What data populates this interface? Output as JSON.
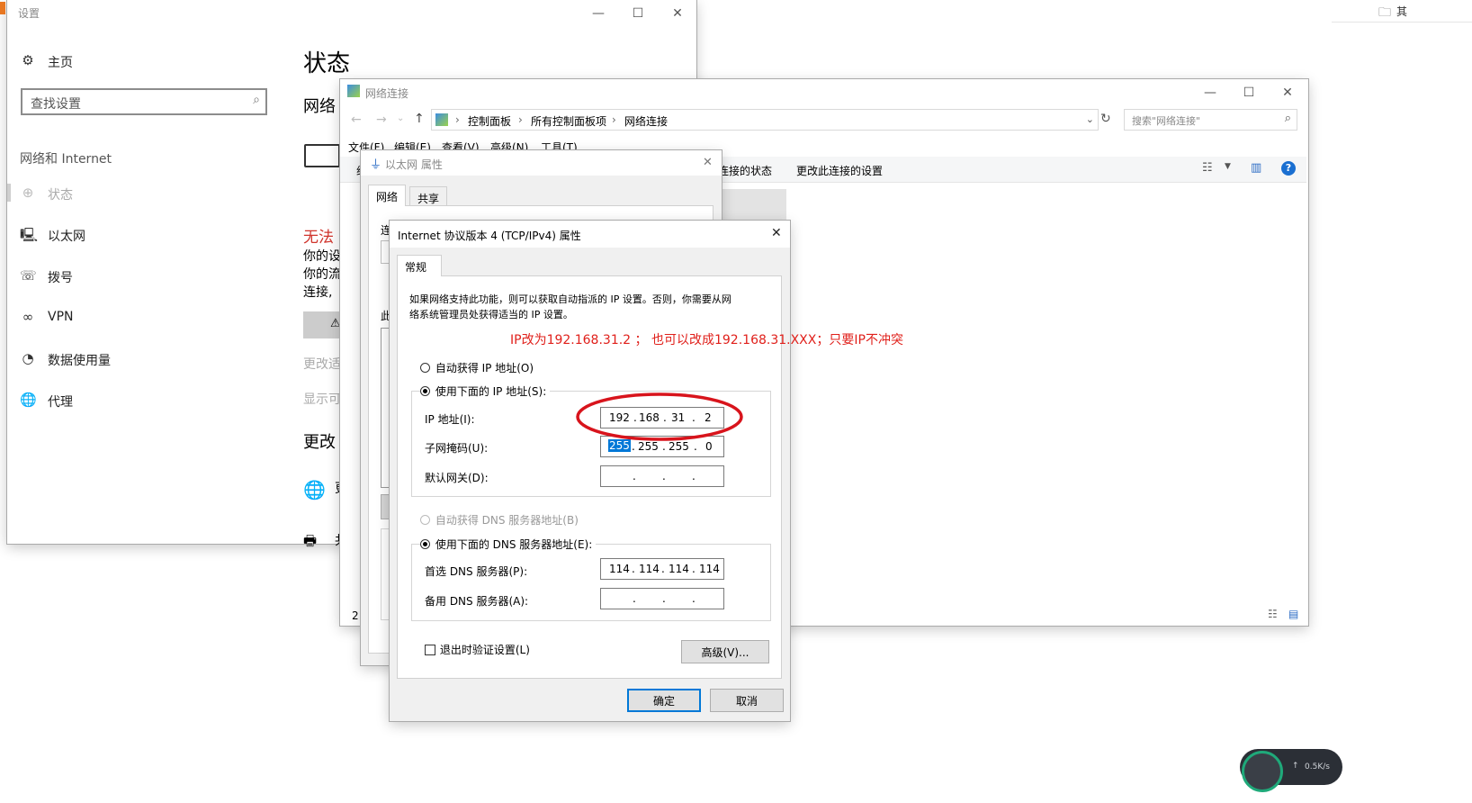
{
  "settings": {
    "title": "设置",
    "home": "主页",
    "search_placeholder": "查找设置",
    "section": "网络和 Internet",
    "nav": [
      "状态",
      "以太网",
      "拨号",
      "VPN",
      "数据使用量",
      "代理"
    ],
    "main_title": "状态",
    "main_subtitle": "网络",
    "error_title": "无法",
    "error_lines": [
      "你的设",
      "你的流",
      "连接,"
    ],
    "link1": "更改适",
    "link2": "显示可",
    "section2": "更改",
    "row_snip1": "更",
    "row_snip2": "共"
  },
  "netconn": {
    "title": "网络连接",
    "breadcrumb": [
      "控制面板",
      "所有控制面板项",
      "网络连接"
    ],
    "search_placeholder": "搜索\"网络连接\"",
    "menu": [
      "文件(F)",
      "编辑(E)",
      "查看(V)",
      "高级(N)",
      "工具(T)"
    ],
    "cmd_status": "连接的状态",
    "cmd_change": "更改此连接的设置",
    "left_snip": "组",
    "status_count": "2"
  },
  "eth": {
    "title": "以太网 属性",
    "tabs": [
      "网络",
      "共享"
    ],
    "connect_snip": "连",
    "this_snip": "此"
  },
  "ipv4": {
    "title": "Internet 协议版本 4 (TCP/IPv4) 属性",
    "tab": "常规",
    "desc_line1": "如果网络支持此功能，则可以获取自动指派的 IP 设置。否则，你需要从网",
    "desc_line2": "络系统管理员处获得适当的 IP 设置。",
    "annotation": "IP改为192.168.31.2 ；  也可以改成192.168.31.XXX；只要IP不冲突",
    "auto_ip": "自动获得 IP 地址(O)",
    "use_ip": "使用下面的 IP 地址(S):",
    "ip_label": "IP 地址(I):",
    "mask_label": "子网掩码(U):",
    "gw_label": "默认网关(D):",
    "ip": [
      "192",
      "168",
      "31",
      "2"
    ],
    "mask": [
      "255",
      "255",
      "255",
      "0"
    ],
    "auto_dns": "自动获得 DNS 服务器地址(B)",
    "use_dns": "使用下面的 DNS 服务器地址(E):",
    "dns1_label": "首选 DNS 服务器(P):",
    "dns2_label": "备用 DNS 服务器(A):",
    "dns1": [
      "114",
      "114",
      "114",
      "114"
    ],
    "validate": "退出时验证设置(L)",
    "advanced": "高级(V)...",
    "ok": "确定",
    "cancel": "取消"
  },
  "taskbar": {
    "speed": "0.5K/s",
    "corner_text": "其"
  },
  "colors": {
    "accent": "#0078d7",
    "annotation_red": "#e0201b",
    "error_red": "#d0342c",
    "help_blue": "#1a6fd1"
  }
}
